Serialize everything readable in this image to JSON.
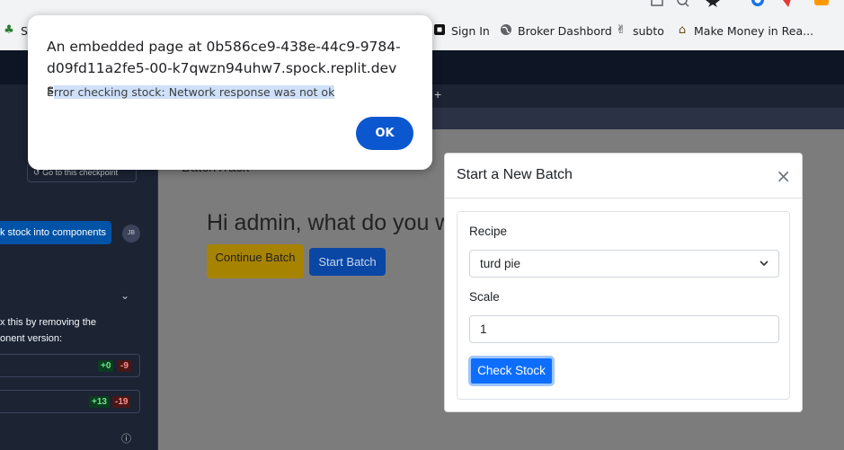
{
  "bookmarks": [
    {
      "label": "S",
      "icon": "app-icon"
    },
    {
      "label": "Sign In",
      "icon": "square-logo-icon"
    },
    {
      "label": "Broker Dashbord",
      "icon": "globe-icon"
    },
    {
      "label": "subto",
      "icon": "peace-hand-icon"
    },
    {
      "label": "Make Money in Rea...",
      "icon": "house-icon"
    }
  ],
  "left_panel": {
    "checkpoint_button": "Go to this checkpoint",
    "chip_label": "k stock into components",
    "avatar": "JB",
    "note_line1": "x this by removing the",
    "note_line2": "onent version:",
    "file_rows": [
      {
        "add": "+0",
        "del": "-9"
      },
      {
        "add": "+13",
        "del": "-19"
      }
    ]
  },
  "preview": {
    "brand": "BatchTrack",
    "heading": "Hi admin, what do you w",
    "continue_button": "Continue Batch",
    "start_button": "Start Batch"
  },
  "modal": {
    "title": "Start a New Batch",
    "close": "×",
    "recipe_label": "Recipe",
    "recipe_value": "turd pie",
    "scale_label": "Scale",
    "scale_value": "1",
    "check_button": "Check Stock"
  },
  "alert": {
    "title": "An embedded page at 0b586ce9-438e-44c9-9784-d09fd11a2fe5-00-k7qwzn94uhw7.spock.replit.dev says",
    "message_prefix": "E",
    "message_highlight": "rror checking stock: Network response was not ok",
    "ok_button": "OK"
  },
  "colors": {
    "primary": "#0d6efd",
    "warning": "#a78302",
    "chrome_ok": "#0b57d0",
    "replit_dark": "#1c2333"
  }
}
